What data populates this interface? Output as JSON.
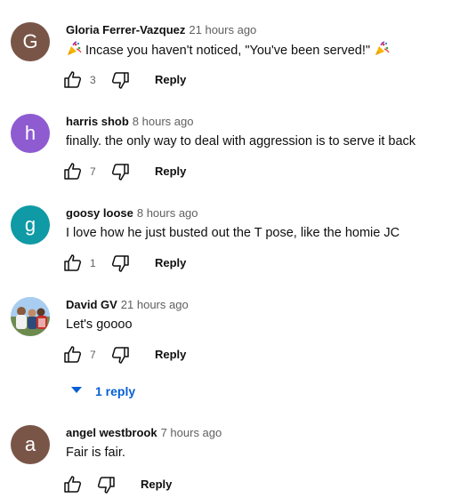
{
  "comments": [
    {
      "author": "Gloria Ferrer-Vazquez",
      "time": "21 hours ago",
      "avatar_letter": "G",
      "avatar_color": "#795548",
      "text": "Incase you haven't noticed, \"You've been served!\"",
      "emoji": "party-popper",
      "likes": "3",
      "reply_label": "Reply"
    },
    {
      "author": "harris shob",
      "time": "8 hours ago",
      "avatar_letter": "h",
      "avatar_color": "#8e5bd1",
      "text": "finally. the only way to deal with aggression is to serve it back",
      "likes": "7",
      "reply_label": "Reply"
    },
    {
      "author": "goosy loose",
      "time": "8 hours ago",
      "avatar_letter": "g",
      "avatar_color": "#0f9aa5",
      "text": "I love how he just busted out the T pose, like the homie JC",
      "likes": "1",
      "reply_label": "Reply"
    },
    {
      "author": "David GV",
      "time": "21 hours ago",
      "avatar": "photo-avatar",
      "text": "Let's goooo",
      "likes": "7",
      "reply_label": "Reply",
      "replies_label": "1 reply"
    },
    {
      "author": "angel westbrook",
      "time": "7 hours ago",
      "avatar_letter": "a",
      "avatar_color": "#795548",
      "text": "Fair is fair.",
      "reply_label": "Reply"
    }
  ],
  "icons": {
    "like": "thumbs-up-icon",
    "dislike": "thumbs-down-icon",
    "expand": "caret-down-icon",
    "emoji": "party-popper-icon"
  },
  "colors": {
    "link_blue": "#065fd4",
    "secondary_text": "#606060"
  }
}
